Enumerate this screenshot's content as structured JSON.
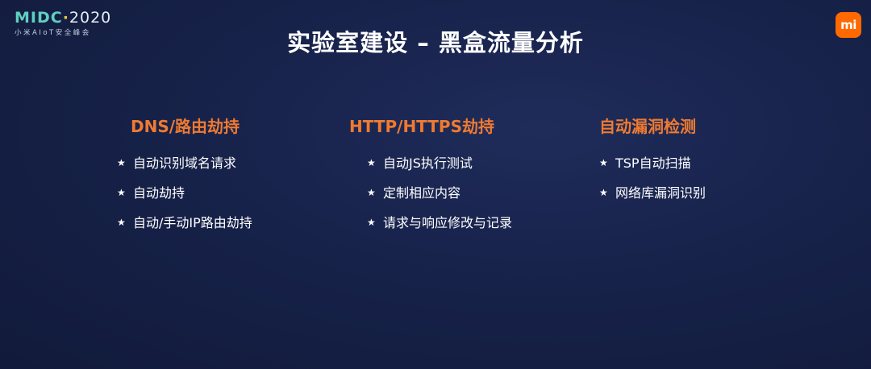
{
  "logo": {
    "brand": "MIDC",
    "year": "2020",
    "subtitle": "小米AIoT安全峰会"
  },
  "mi_badge": "mi",
  "title": "实验室建设 – 黑盒流量分析",
  "columns": [
    {
      "heading": "DNS/路由劫持",
      "items": [
        "自动识别域名请求",
        "自动劫持",
        "自动/手动IP路由劫持"
      ]
    },
    {
      "heading": "HTTP/HTTPS劫持",
      "items": [
        "自动JS执行测试",
        "定制相应内容",
        "请求与响应修改与记录"
      ]
    },
    {
      "heading": "自动漏洞检测",
      "items": [
        "TSP自动扫描",
        "网络库漏洞识别"
      ]
    }
  ],
  "bullet_glyph": "★",
  "colors": {
    "background": "#17224a",
    "heading_accent": "#ef7a31",
    "mi_orange": "#ff6900",
    "logo_teal": "#5fd0c0"
  }
}
